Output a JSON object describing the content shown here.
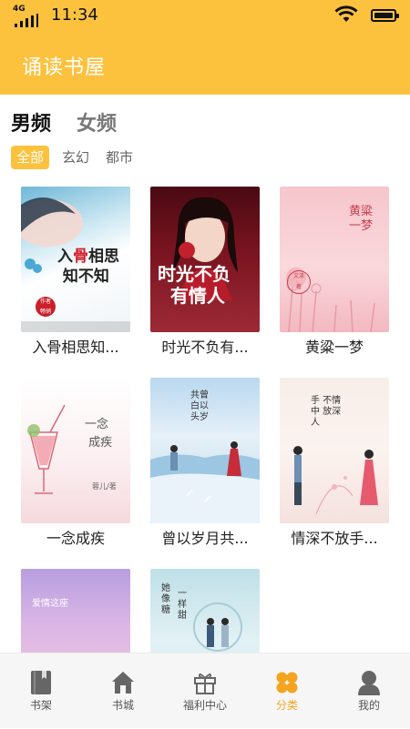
{
  "status_bar": {
    "network": "4G",
    "time": "11:34"
  },
  "app": {
    "title": "诵读书屋"
  },
  "gender_tabs": [
    {
      "label": "男频",
      "active": true
    },
    {
      "label": "女频",
      "active": false
    }
  ],
  "category_tabs": [
    {
      "label": "全部",
      "active": true
    },
    {
      "label": "玄幻",
      "active": false
    },
    {
      "label": "都市",
      "active": false
    }
  ],
  "books": [
    {
      "title": "入骨相思知...",
      "cover_text": "入骨相思知不知"
    },
    {
      "title": "时光不负有...",
      "cover_text": "时光不负有情人"
    },
    {
      "title": "黄粱一梦",
      "cover_text": "黄粱一梦"
    },
    {
      "title": "一念成疾",
      "cover_text": "一念成疾"
    },
    {
      "title": "曾以岁月共...",
      "cover_text": "曾以岁月共白头"
    },
    {
      "title": "情深不放手...",
      "cover_text": "情深不放手中人"
    },
    {
      "title": "",
      "cover_text": "爱情这座"
    },
    {
      "title": "",
      "cover_text": "她像糖一样甜"
    }
  ],
  "bottom_nav": [
    {
      "label": "书架",
      "icon": "book-icon",
      "active": false
    },
    {
      "label": "书城",
      "icon": "home-icon",
      "active": false
    },
    {
      "label": "福利中心",
      "icon": "gift-icon",
      "active": false
    },
    {
      "label": "分类",
      "icon": "category-icon",
      "active": true
    },
    {
      "label": "我的",
      "icon": "user-icon",
      "active": false
    }
  ],
  "colors": {
    "accent": "#fcc23e",
    "nav_active": "#f4a41e"
  }
}
